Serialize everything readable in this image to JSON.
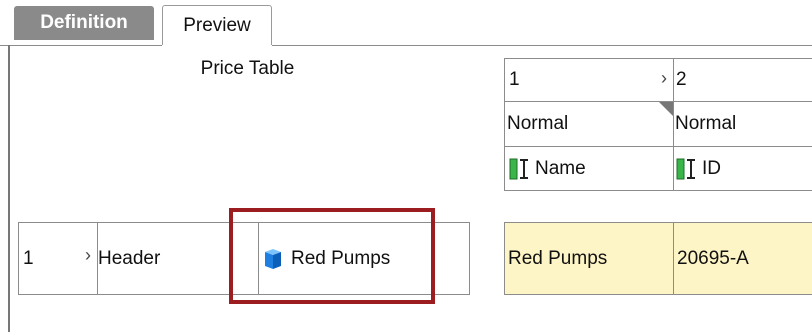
{
  "tabs": [
    {
      "label": "Definition"
    },
    {
      "label": "Preview"
    }
  ],
  "price_table_label": "Price Table",
  "columns": [
    {
      "number": "1",
      "style": "Normal",
      "field": "Name"
    },
    {
      "number": "2",
      "style": "Normal",
      "field": "ID"
    }
  ],
  "row": {
    "number": "1",
    "type": "Header",
    "value": "Red Pumps"
  },
  "preview_row": {
    "name": "Red Pumps",
    "id": "20695-A"
  },
  "colors": {
    "highlight": "#9b1d20",
    "cell_fill": "#fef5c6",
    "tab_active": "#8a8a8a"
  }
}
